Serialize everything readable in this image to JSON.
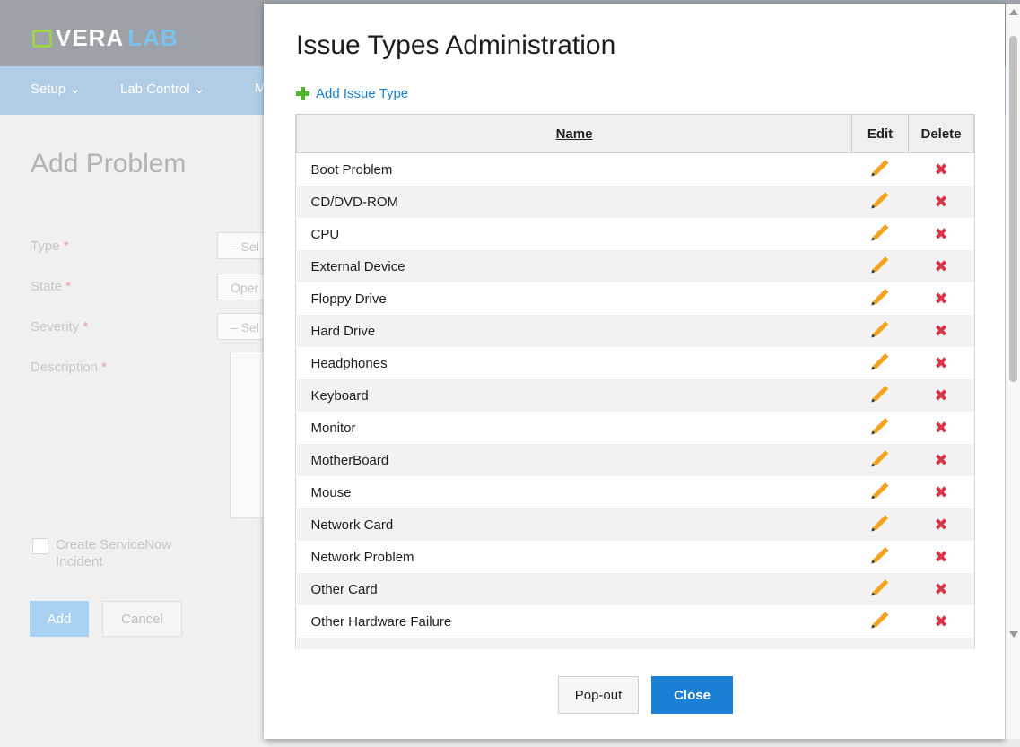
{
  "background": {
    "logo": {
      "part1": "VERA",
      "part2": "LAB"
    },
    "nav": [
      "Setup ⌄",
      "Lab Control ⌄",
      "M"
    ],
    "page_title": "Add Problem",
    "fields": [
      {
        "label": "Type",
        "value": "– Sel"
      },
      {
        "label": "State",
        "value": "Oper"
      },
      {
        "label": "Severity",
        "value": "– Sel"
      },
      {
        "label": "Description",
        "value": ""
      }
    ],
    "required_mark": "*",
    "checkbox_label": "Create ServiceNow Incident",
    "add_label": "Add",
    "cancel_label": "Cancel"
  },
  "modal": {
    "title": "Issue Types Administration",
    "add_link": "Add Issue Type",
    "columns": {
      "name": "Name",
      "edit": "Edit",
      "delete": "Delete"
    },
    "rows": [
      "Boot Problem",
      "CD/DVD-ROM",
      "CPU",
      "External Device",
      "Floppy Drive",
      "Hard Drive",
      "Headphones",
      "Keyboard",
      "Monitor",
      "MotherBoard",
      "Mouse",
      "Network Card",
      "Network Problem",
      "Other Card",
      "Other Hardware Failure"
    ],
    "popout_label": "Pop-out",
    "close_label": "Close"
  },
  "colors": {
    "accent": "#1b7fd4",
    "add_icon": "#51b52f",
    "edit_icon": "#f3a21c",
    "delete_icon": "#d6344b"
  }
}
